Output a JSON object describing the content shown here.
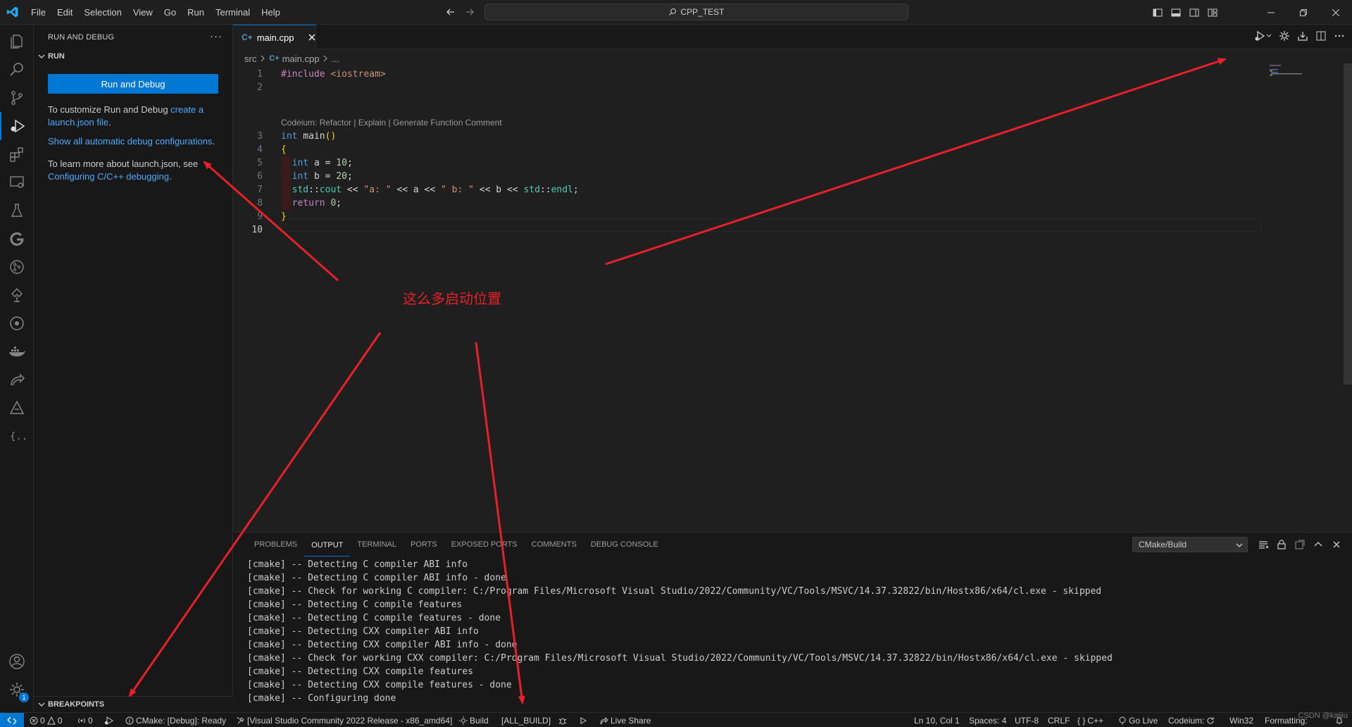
{
  "menu": [
    "File",
    "Edit",
    "Selection",
    "View",
    "Go",
    "Run",
    "Terminal",
    "Help"
  ],
  "search_title": "CPP_TEST",
  "sidebar": {
    "title": "RUN AND DEBUG",
    "more": "···",
    "section": "RUN",
    "run_button": "Run and Debug",
    "p1a": "To customize Run and Debug ",
    "p1link": "create a launch.json file",
    ".p1end": ".",
    "p2link": "Show all automatic debug configurations",
    "p2end": ".",
    "p3a": "To learn more about launch.json, see ",
    "p3link": "Configuring C/C++ debugging",
    "p3end": ".",
    "breakpoints": "BREAKPOINTS"
  },
  "tab": {
    "icon_text": "C+",
    "label": "main.cpp"
  },
  "breadcrumb": {
    "folder": "src",
    "file": "main.cpp",
    "more": "..."
  },
  "codelens": "Codeium: Refactor | Explain | Generate Function Comment",
  "code": {
    "line_numbers": [
      "1",
      "2",
      "3",
      "4",
      "5",
      "6",
      "7",
      "8",
      "9",
      "10"
    ]
  },
  "panel": {
    "tabs": [
      "PROBLEMS",
      "OUTPUT",
      "TERMINAL",
      "PORTS",
      "EXPOSED PORTS",
      "COMMENTS",
      "DEBUG CONSOLE"
    ],
    "active_tab": "OUTPUT",
    "channel": "CMake/Build",
    "output": [
      "[cmake] -- Detecting C compiler ABI info",
      "[cmake] -- Detecting C compiler ABI info - done",
      "[cmake] -- Check for working C compiler: C:/Program Files/Microsoft Visual Studio/2022/Community/VC/Tools/MSVC/14.37.32822/bin/Hostx86/x64/cl.exe - skipped",
      "[cmake] -- Detecting C compile features",
      "[cmake] -- Detecting C compile features - done",
      "[cmake] -- Detecting CXX compiler ABI info",
      "[cmake] -- Detecting CXX compiler ABI info - done",
      "[cmake] -- Check for working CXX compiler: C:/Program Files/Microsoft Visual Studio/2022/Community/VC/Tools/MSVC/14.37.32822/bin/Hostx86/x64/cl.exe - skipped",
      "[cmake] -- Detecting CXX compile features",
      "[cmake] -- Detecting CXX compile features - done",
      "[cmake] -- Configuring done"
    ]
  },
  "status": {
    "errors": "0",
    "warnings": "0",
    "ports": "0",
    "cmake": "CMake: [Debug]: Ready",
    "kit": "[Visual Studio Community 2022 Release - x86_amd64]",
    "build": "Build",
    "target": "[ALL_BUILD]",
    "liveshare": "Live Share",
    "position": "Ln 10, Col 1",
    "spaces": "Spaces: 4",
    "encoding": "UTF-8",
    "eol": "CRLF",
    "lang_brace": "{ }",
    "language": "C++",
    "golive": "Go Live",
    "codeium": "Codeium:",
    "platform": "Win32",
    "formatting": "Formatting:"
  },
  "annotation": {
    "text": "这么多启动位置",
    "color": "#e8202a"
  },
  "watermark": "CSDN @kaijiu",
  "badge": "1"
}
